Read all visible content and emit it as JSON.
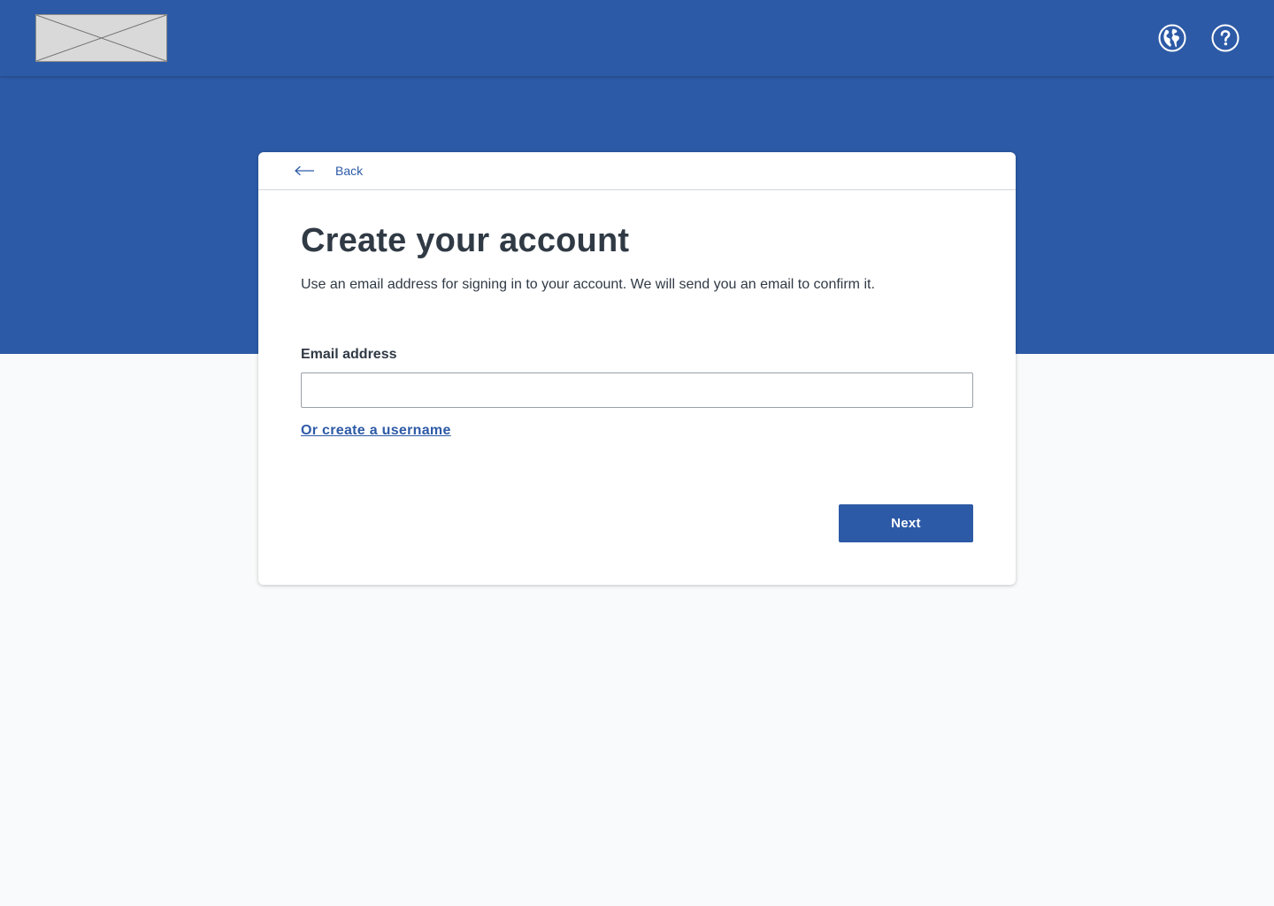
{
  "header": {
    "logo_icon": "image-placeholder-icon",
    "language_icon": "globe-icon",
    "help_icon": "help-circle-icon"
  },
  "card": {
    "back_label": "Back",
    "back_icon": "arrow-left-icon",
    "title": "Create your account",
    "subtitle": "Use an email address for signing in to your account. We will send you an email to confirm it.",
    "email_label": "Email address",
    "email_value": "",
    "email_placeholder": "",
    "username_link": "Or create a username",
    "next_label": "Next"
  },
  "colors": {
    "brand_blue": "#2d5aa6",
    "page_background": "#f9fafb",
    "text_primary": "#303a45"
  }
}
